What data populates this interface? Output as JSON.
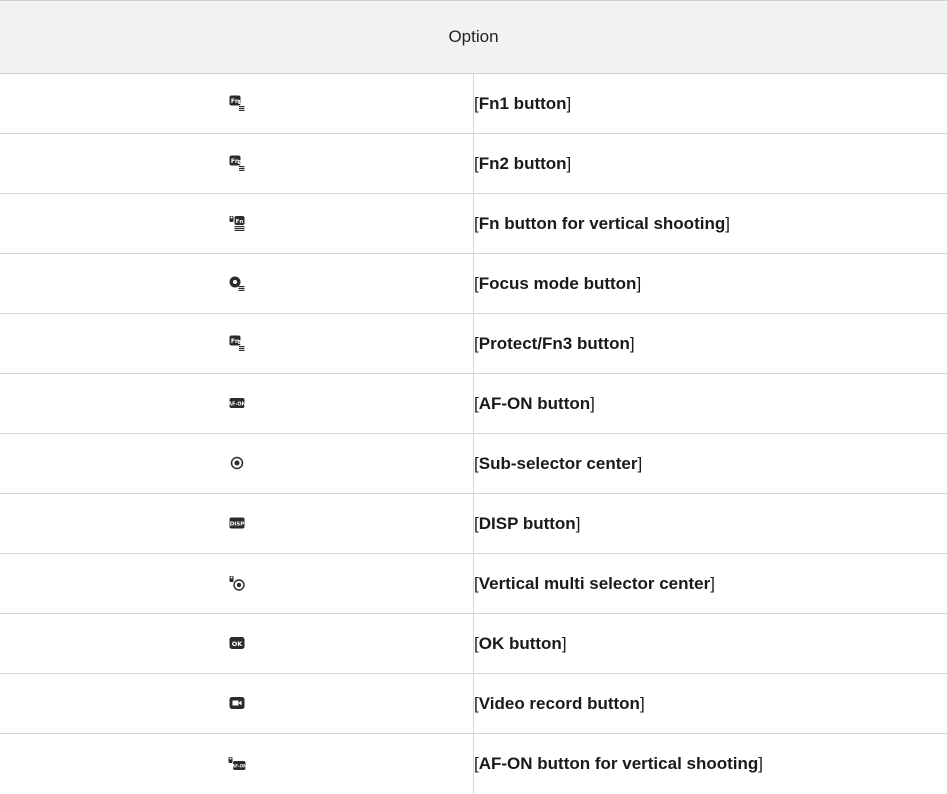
{
  "table": {
    "header": "Option",
    "rows": [
      {
        "icon": "fn1-button-icon",
        "open": "[",
        "label": "Fn1 button",
        "close": "]"
      },
      {
        "icon": "fn2-button-icon",
        "open": "[",
        "label": "Fn2 button",
        "close": "]"
      },
      {
        "icon": "fn-vertical-button-icon",
        "open": "[",
        "label": "Fn button for vertical shooting",
        "close": "]"
      },
      {
        "icon": "focus-mode-button-icon",
        "open": "[",
        "label": "Focus mode button",
        "close": "]"
      },
      {
        "icon": "protect-fn3-button-icon",
        "open": "[",
        "label": "Protect/Fn3 button",
        "close": "]"
      },
      {
        "icon": "af-on-button-icon",
        "open": "[",
        "label": "AF-ON button",
        "close": "]"
      },
      {
        "icon": "sub-selector-center-icon",
        "open": "[",
        "label": "Sub-selector center",
        "close": "]"
      },
      {
        "icon": "disp-button-icon",
        "open": "[",
        "label": "DISP button",
        "close": "]"
      },
      {
        "icon": "vertical-multi-selector-center-icon",
        "open": "[",
        "label": "Vertical multi selector center",
        "close": "]"
      },
      {
        "icon": "ok-button-icon",
        "open": "[",
        "label": "OK button",
        "close": "]"
      },
      {
        "icon": "video-record-button-icon",
        "open": "[",
        "label": "Video record button",
        "close": "]"
      },
      {
        "icon": "af-on-vertical-button-icon",
        "open": "[",
        "label": "AF-ON button for vertical shooting",
        "close": "]"
      }
    ]
  },
  "colors": {
    "header_bg": "#f2f2f2",
    "rule": "#d6d6d6",
    "icon_fill": "#2b2b2b"
  }
}
